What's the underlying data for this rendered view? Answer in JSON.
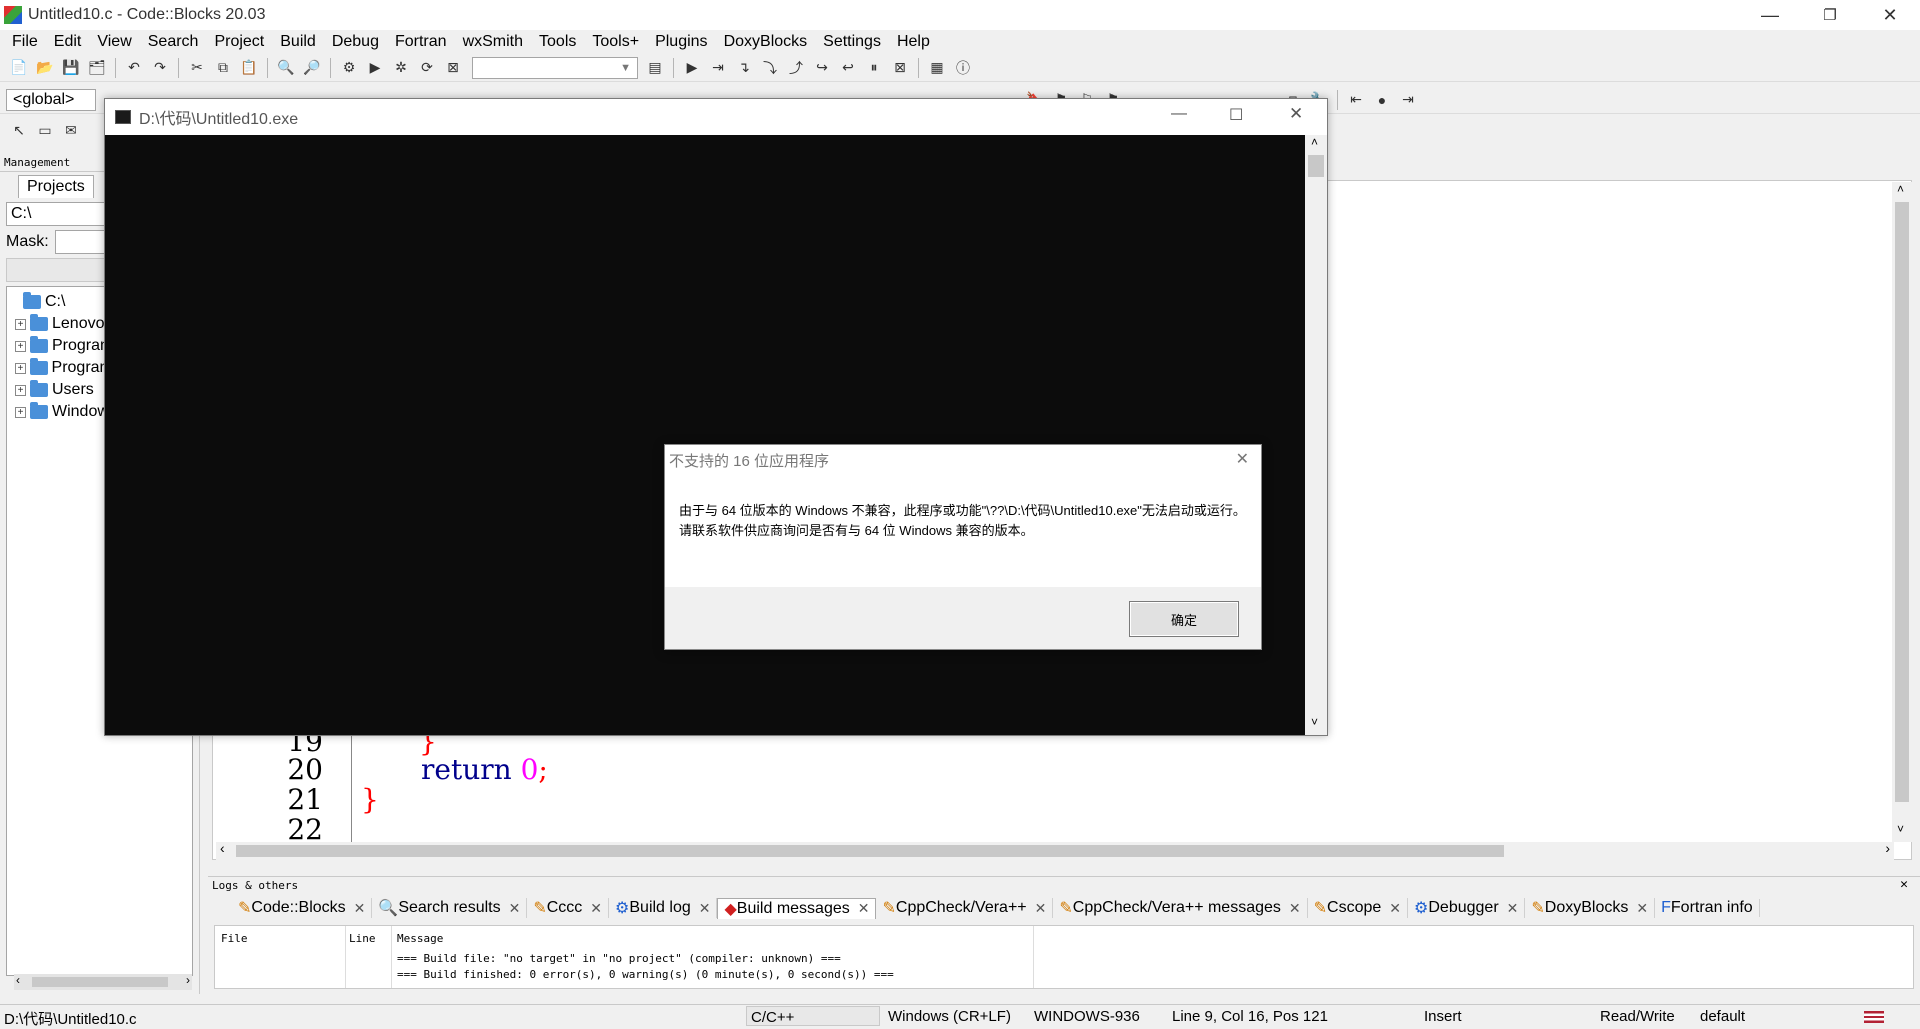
{
  "window": {
    "title": "Untitled10.c - Code::Blocks 20.03",
    "minimize": "—",
    "restore": "❐",
    "close": "✕"
  },
  "menu": [
    "File",
    "Edit",
    "View",
    "Search",
    "Project",
    "Build",
    "Debug",
    "Fortran",
    "wxSmith",
    "Tools",
    "Tools+",
    "Plugins",
    "DoxyBlocks",
    "Settings",
    "Help"
  ],
  "toolbar": {
    "scope_combo": "<global>"
  },
  "management": {
    "header": "Management",
    "tab_projects": "Projects",
    "path": "C:\\",
    "mask_label": "Mask:",
    "tree": [
      {
        "label": "C:\\",
        "expandable": false
      },
      {
        "label": "Lenovo",
        "expandable": true
      },
      {
        "label": "Program Files",
        "expandable": true
      },
      {
        "label": "Program Files (x86)",
        "expandable": true
      },
      {
        "label": "Users",
        "expandable": true
      },
      {
        "label": "Windows",
        "expandable": true
      }
    ]
  },
  "editor": {
    "lines": [
      {
        "num": "19",
        "code": "}"
      },
      {
        "num": "20",
        "code": "return 0;"
      },
      {
        "num": "21",
        "code": "}"
      },
      {
        "num": "22",
        "code": ""
      }
    ]
  },
  "logs": {
    "header": "Logs & others",
    "tabs": [
      {
        "label": "Code::Blocks",
        "active": false
      },
      {
        "label": "Search results",
        "active": false
      },
      {
        "label": "Cccc",
        "active": false
      },
      {
        "label": "Build log",
        "active": false
      },
      {
        "label": "Build messages",
        "active": true
      },
      {
        "label": "CppCheck/Vera++",
        "active": false
      },
      {
        "label": "CppCheck/Vera++ messages",
        "active": false
      },
      {
        "label": "Cscope",
        "active": false
      },
      {
        "label": "Debugger",
        "active": false
      },
      {
        "label": "DoxyBlocks",
        "active": false
      },
      {
        "label": "Fortran info",
        "active": false
      }
    ],
    "columns": [
      "File",
      "Line",
      "Message"
    ],
    "messages": [
      "=== Build file: \"no target\" in \"no project\" (compiler: unknown) ===",
      "=== Build finished: 0 error(s), 0 warning(s) (0 minute(s), 0 second(s)) ==="
    ]
  },
  "statusbar": {
    "file": "D:\\代码\\Untitled10.c",
    "language": "C/C++",
    "line_endings": "Windows (CR+LF)",
    "encoding": "WINDOWS-936",
    "position": "Line 9, Col 16, Pos 121",
    "mode": "Insert",
    "access": "Read/Write",
    "profile": "default"
  },
  "console": {
    "title": "D:\\代码\\Untitled10.exe"
  },
  "dialog": {
    "title": "不支持的 16 位应用程序",
    "message": "由于与 64 位版本的 Windows 不兼容，此程序或功能\"\\??\\D:\\代码\\Untitled10.exe\"无法启动或运行。请联系软件供应商询问是否有与 64 位 Windows 兼容的版本。",
    "ok_label": "确定"
  },
  "colors": {
    "keyword": "#00008b",
    "number": "#ff00ff",
    "brace": "#ff0000",
    "console_bg": "#0c0c0c"
  }
}
